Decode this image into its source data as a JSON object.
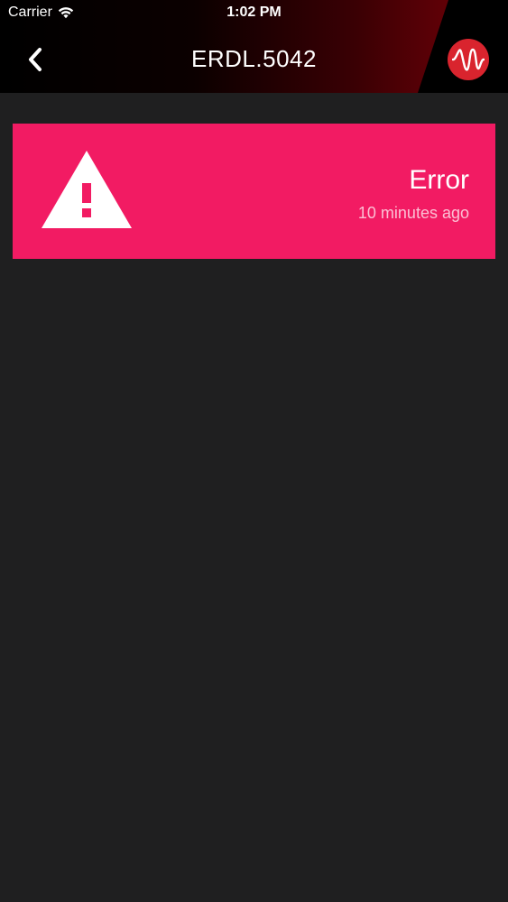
{
  "status_bar": {
    "carrier": "Carrier",
    "time": "1:02 PM"
  },
  "nav": {
    "title": "ERDL.5042",
    "back_icon": "chevron-left-icon",
    "logo_icon": "waveform-logo-icon"
  },
  "alert": {
    "title": "Error",
    "time_ago": "10 minutes ago",
    "icon": "warning-triangle-icon",
    "color": "#f21b63"
  },
  "colors": {
    "background": "#1f1f20",
    "logo_red": "#d9242e"
  }
}
